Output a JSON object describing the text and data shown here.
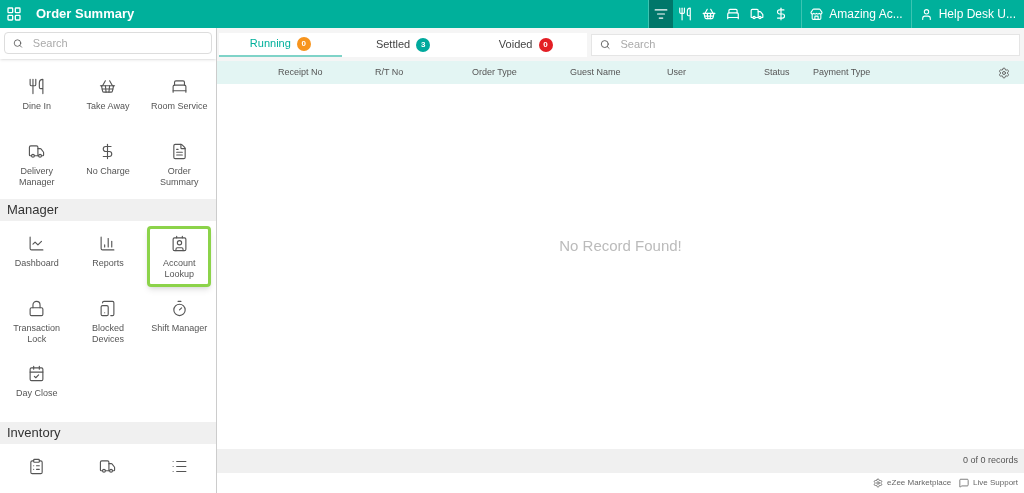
{
  "header": {
    "title": "Order Summary",
    "toolbar": [
      {
        "selected": true
      },
      {
        "selected": false
      },
      {
        "selected": false
      },
      {
        "selected": false
      },
      {
        "selected": false
      },
      {
        "selected": false
      }
    ],
    "outlet": "Amazing Ac...",
    "user": "Help Desk U..."
  },
  "sidebar": {
    "search": {
      "placeholder": "Search"
    },
    "sections": [
      {
        "items": [
          {
            "label": "Dine In",
            "selected": false
          },
          {
            "label": "Take Away",
            "selected": false
          },
          {
            "label": "Room Service",
            "selected": false
          },
          {
            "label": "Delivery Manager",
            "selected": false
          },
          {
            "label": "No Charge",
            "selected": false
          },
          {
            "label": "Order Summary",
            "selected": false
          }
        ]
      },
      {
        "title": "Manager",
        "items": [
          {
            "label": "Dashboard",
            "selected": false
          },
          {
            "label": "Reports",
            "selected": false
          },
          {
            "label": "Account Lookup",
            "selected": true
          },
          {
            "label": "Transaction Lock",
            "selected": false
          },
          {
            "label": "Blocked Devices",
            "selected": false
          },
          {
            "label": "Shift Manager",
            "selected": false
          },
          {
            "label": "Day Close",
            "selected": false
          }
        ]
      },
      {
        "title": "Inventory",
        "items": [
          {
            "selected": false
          },
          {
            "selected": false
          },
          {
            "selected": false
          }
        ]
      }
    ]
  },
  "tabs": [
    {
      "label": "Running",
      "count": "0",
      "color": "#f7941d",
      "selected": true
    },
    {
      "label": "Settled",
      "count": "3",
      "color": "#00a99d",
      "selected": false
    },
    {
      "label": "Voided",
      "count": "0",
      "color": "#e31e24",
      "selected": false
    }
  ],
  "search": {
    "placeholder": "Search"
  },
  "table": {
    "columns": [
      "Receipt No",
      "R/T No",
      "Order Type",
      "Guest Name",
      "User",
      "Status",
      "Payment Type"
    ],
    "empty_message": "No Record Found!"
  },
  "footer": {
    "records": "0 of 0 records"
  },
  "bottom_bar": {
    "links": [
      "eZee Marketplace",
      "Live Support"
    ]
  }
}
